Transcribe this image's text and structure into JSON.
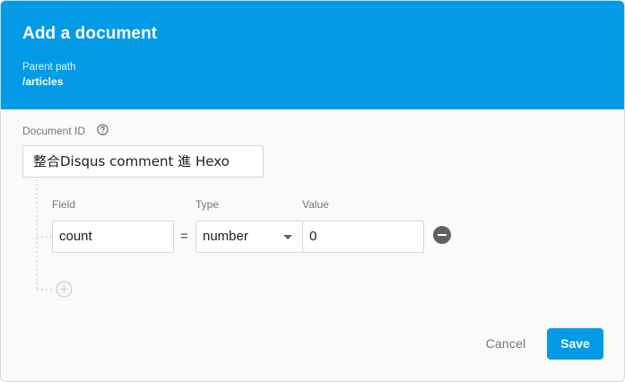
{
  "dialog": {
    "title": "Add a document",
    "parent_path_label": "Parent path",
    "parent_path_value": "/articles"
  },
  "document_id": {
    "label": "Document ID",
    "value": "整合Disqus comment 進 Hexo",
    "help_icon": "help-circle-icon"
  },
  "fields": {
    "column_labels": {
      "field": "Field",
      "type": "Type",
      "value": "Value"
    },
    "rows": [
      {
        "field": "count",
        "operator": "=",
        "type": "number",
        "value": "0"
      }
    ],
    "add_icon": "add-circle-icon",
    "remove_icon": "remove-circle-icon"
  },
  "actions": {
    "cancel_label": "Cancel",
    "save_label": "Save"
  },
  "colors": {
    "accent": "#039be5",
    "header_text": "#ffffff",
    "body_bg": "#fafafa"
  }
}
